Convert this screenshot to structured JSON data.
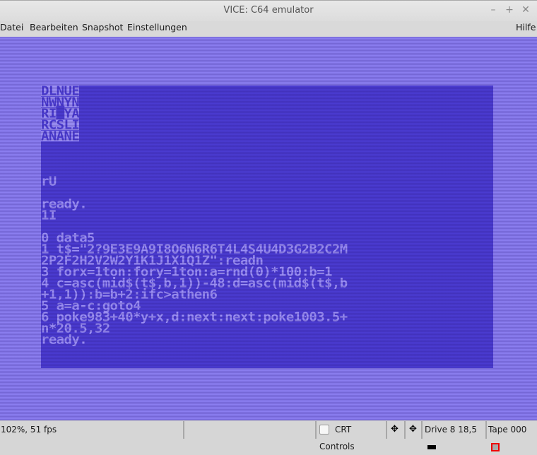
{
  "window": {
    "title": "VICE: C64 emulator",
    "controls": {
      "minimize": "–",
      "maximize": "+",
      "close": "✕"
    }
  },
  "menu": {
    "items": [
      "Datei",
      "Bearbeiten",
      "Snapshot",
      "Einstellungen"
    ],
    "help": "Hilfe"
  },
  "c64": {
    "colors": {
      "border": "#8b7ef0",
      "background": "#4a3bd0",
      "text": "#9d91f5"
    },
    "reverse_rows": [
      "DLNUE",
      "NWNYN",
      "RI█YA",
      "RCSLI",
      "ANANE"
    ],
    "lines": [
      {
        "row": 8,
        "text": "rU"
      },
      {
        "row": 10,
        "text": "ready."
      },
      {
        "row": 11,
        "text": "1I"
      },
      {
        "row": 13,
        "text": "0 data5"
      },
      {
        "row": 14,
        "text": "1 t$=\"2?9E3E9A9I8O6N6R6T4L4S4U4D3G2B2C2M"
      },
      {
        "row": 15,
        "text": "2P2F2H2V2W2Y1K1J1X1Q1Z\":readn"
      },
      {
        "row": 16,
        "text": "3 forx=1ton:fory=1ton:a=rnd(0)*100:b=1"
      },
      {
        "row": 17,
        "text": "4 c=asc(mid$(t$,b,1))-48:d=asc(mid$(t$,b"
      },
      {
        "row": 18,
        "text": "+1,1)):b=b+2:ifc>athen6"
      },
      {
        "row": 19,
        "text": "5 a=a-c:goto4"
      },
      {
        "row": 20,
        "text": "6 poke983+40*y+x,d:next:next:poke1003.5+"
      },
      {
        "row": 21,
        "text": "n*20.5,32"
      },
      {
        "row": 22,
        "text": "ready."
      }
    ]
  },
  "status": {
    "speed": "102%, 51 fps",
    "crt_controls": "CRT Controls",
    "crt_checked": false,
    "joystick1": "✥",
    "joystick2": "✥",
    "drive": "Drive 8 18,5",
    "tape": "Tape 000"
  }
}
